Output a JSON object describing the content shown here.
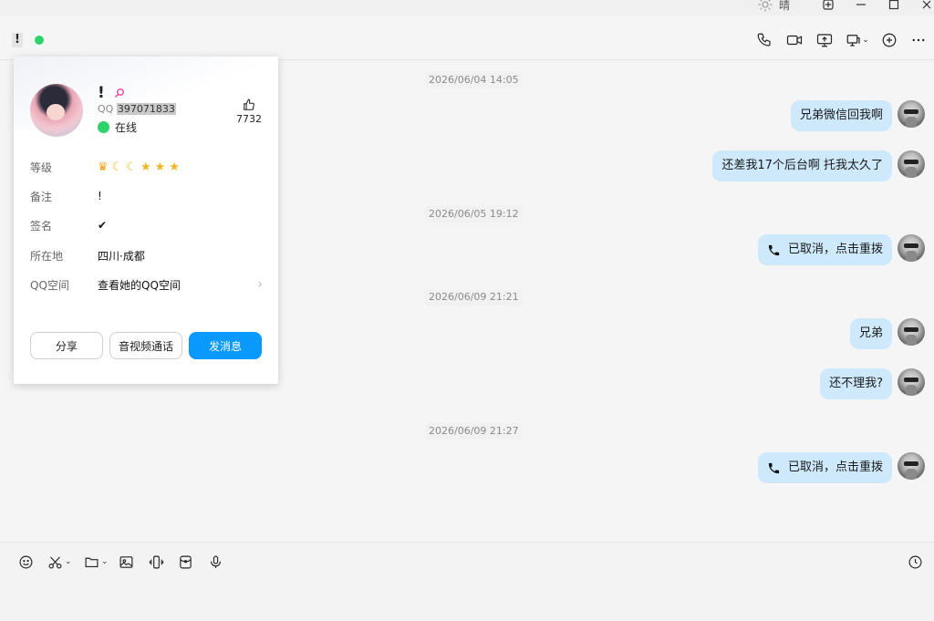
{
  "titlebar": {
    "weather_text": "晴",
    "icons": [
      "sun-icon",
      "pin-icon",
      "minimize-icon",
      "maximize-icon",
      "close-icon"
    ]
  },
  "header": {
    "contact_name": "!",
    "status_color": "#2fd36b",
    "icons": [
      "phone-icon",
      "video-icon",
      "screen-share-icon",
      "remote-assist-icon",
      "add-member-icon",
      "more-icon"
    ]
  },
  "profile_card": {
    "name": "!",
    "qq_label": "QQ",
    "qq_number": "397071833",
    "status": "在线",
    "likes": "7732",
    "rows": [
      {
        "label": "等级",
        "value": ""
      },
      {
        "label": "备注",
        "value": "!"
      },
      {
        "label": "签名",
        "value": "✔"
      },
      {
        "label": "所在地",
        "value": "四川·成都"
      },
      {
        "label": "QQ空间",
        "value": "查看她的QQ空间"
      }
    ],
    "level_badges": [
      "crown",
      "moon",
      "moon",
      "star",
      "star",
      "star"
    ],
    "buttons": {
      "share": "分享",
      "av_call": "音视频通话",
      "send": "发消息"
    },
    "accent_color": "#0a99ff"
  },
  "messages": [
    {
      "type": "time",
      "text": "2026/06/04 14:05"
    },
    {
      "type": "text",
      "text": "兄弟微信回我啊"
    },
    {
      "type": "text",
      "text": "还差我17个后台啊 托我太久了"
    },
    {
      "type": "time",
      "text": "2026/06/05 19:12"
    },
    {
      "type": "call",
      "text": "已取消，点击重拨"
    },
    {
      "type": "time",
      "text": "2026/06/09 21:21"
    },
    {
      "type": "text",
      "text": "兄弟"
    },
    {
      "type": "text",
      "text": "还不理我?"
    },
    {
      "type": "time",
      "text": "2026/06/09 21:27"
    },
    {
      "type": "call",
      "text": "已取消，点击重拨"
    }
  ],
  "composer": {
    "tools": [
      "emoji-icon",
      "screenshot-icon",
      "folder-icon",
      "image-icon",
      "shake-icon",
      "redpacket-icon",
      "voice-icon",
      "history-icon"
    ]
  },
  "bubble_color": "#cde9fb"
}
